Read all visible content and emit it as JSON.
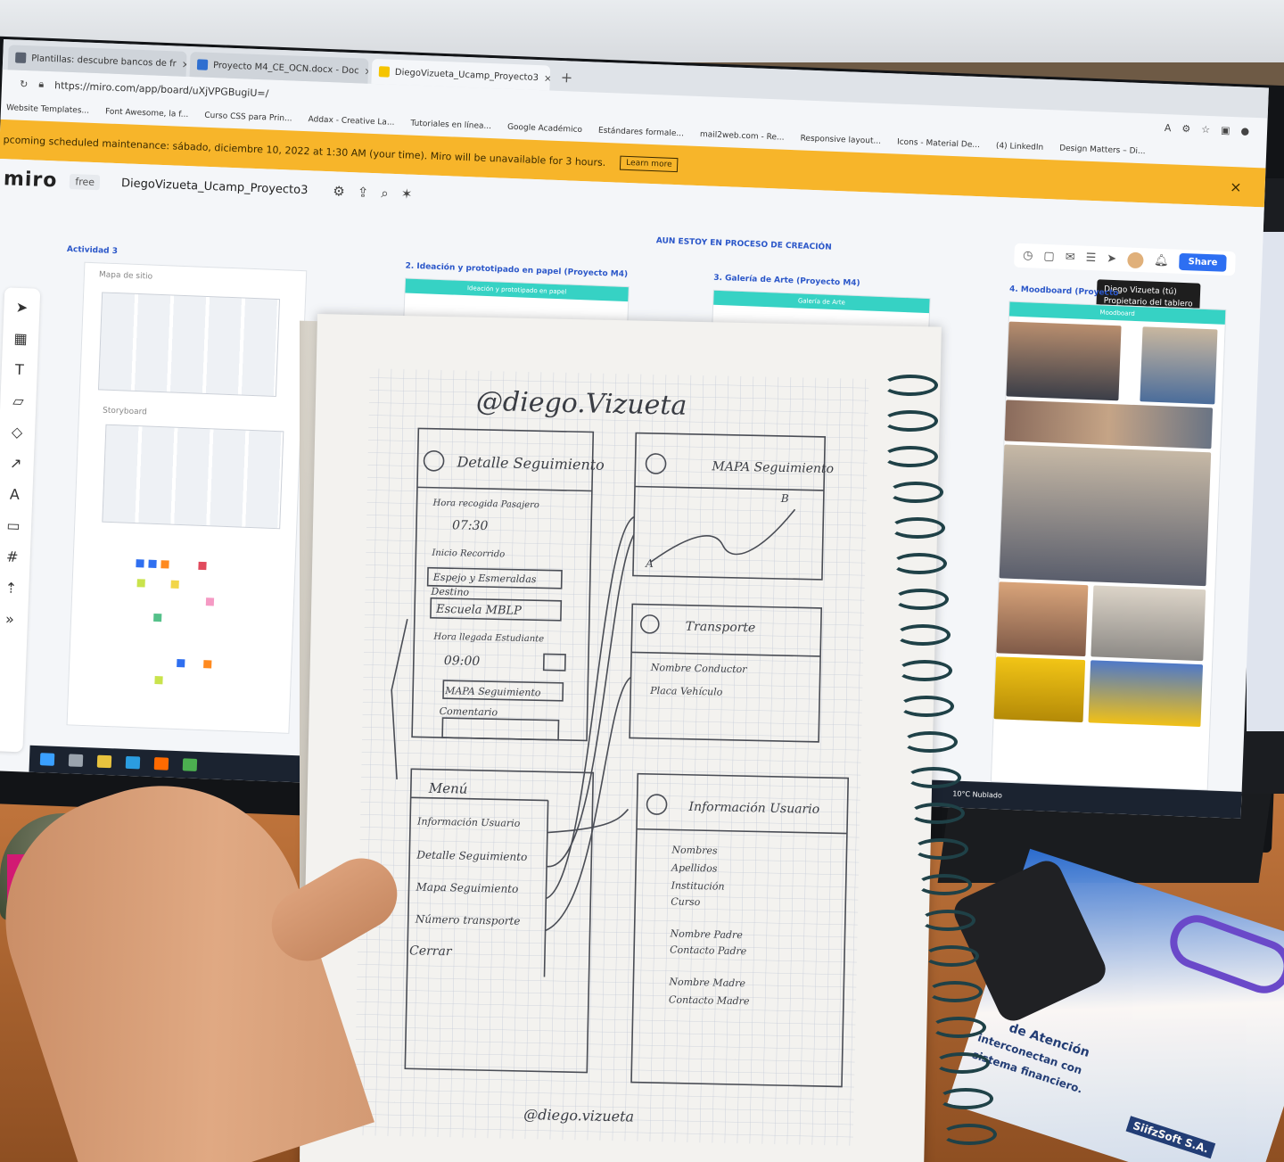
{
  "browser": {
    "tabs": [
      {
        "label": "Plantillas: descubre bancos de fr"
      },
      {
        "label": "Proyecto M4_CE_OCN.docx - Doc"
      },
      {
        "label": "DiegoVizueta_Ucamp_Proyecto3"
      }
    ],
    "url": "https://miro.com/app/board/uXjVPGBugiU=/",
    "bookmarks": [
      "Website Templates...",
      "Font Awesome, la f...",
      "Curso CSS para Prin...",
      "Addax - Creative La...",
      "Tutoriales en línea...",
      "Google Académico",
      "Estándares formale...",
      "mail2web.com - Re...",
      "Responsive layout...",
      "Icons - Material De...",
      "(4) LinkedIn",
      "Design Matters – Di..."
    ]
  },
  "banner": {
    "text": "pcoming scheduled maintenance: sábado, diciembre 10, 2022 at 1:30 AM (your time). Miro will be unavailable for 3 hours.",
    "learn_more": "Learn more",
    "close": "×"
  },
  "miro": {
    "logo": "miro",
    "plan": "free",
    "board_name": "DiegoVizueta_Ucamp_Proyecto3",
    "notice": "AUN ESTOY EN PROCESO DE CREACIÓN",
    "share": "Share",
    "tooltip_name": "Diego Vizueta (tú)",
    "tooltip_role": "Propietario del tablero",
    "frames": {
      "actividad": "Actividad 3",
      "mapa": "Mapa de sitio",
      "storyboard": "Storyboard",
      "ideacion": "2. Ideación y prototipado en papel (Proyecto M4)",
      "ideacion_bar": "Ideación y prototipado en papel",
      "galeria": "3. Galería de Arte (Proyecto M4)",
      "galeria_bar": "Galería de Arte",
      "moodboard": "4. Moodboard (Proyecto",
      "moodboard_bar": "Moodboard"
    },
    "weather": "10°C Nublado"
  },
  "sketch": {
    "title": "@diego.Vizueta",
    "footer": "@diego.vizueta",
    "screen1": {
      "title": "Detalle Seguimiento",
      "items": [
        "Hora recogida Pasajero",
        "07:30",
        "Inicio Recorrido",
        "Espejo y Esmeraldas",
        "Destino",
        "Escuela MBLP",
        "Hora llegada Estudiante",
        "09:00",
        "MAPA Seguimiento",
        "Comentario"
      ]
    },
    "screen2": {
      "title": "MAPA Seguimiento",
      "point_a": "A",
      "point_b": "B"
    },
    "screen3": {
      "title": "Transporte",
      "items": [
        "Nombre Conductor",
        "Placa Vehículo"
      ]
    },
    "screen4": {
      "title": "Menú",
      "items": [
        "Información Usuario",
        "Detalle Seguimiento",
        "Mapa Seguimiento",
        "Número transporte",
        "Cerrar"
      ]
    },
    "screen5": {
      "title": "Información Usuario",
      "items": [
        "Nombres",
        "Apellidos",
        "Institución",
        "Curso",
        "Nombre Padre",
        "Contacto Padre",
        "Nombre Madre",
        "Contacto Madre"
      ]
    }
  },
  "desk": {
    "printed_line1": "de Atención",
    "printed_line2": "interconectan con",
    "printed_line3": "sistema financiero.",
    "printed_brand": "SiifzSoft S.A."
  }
}
